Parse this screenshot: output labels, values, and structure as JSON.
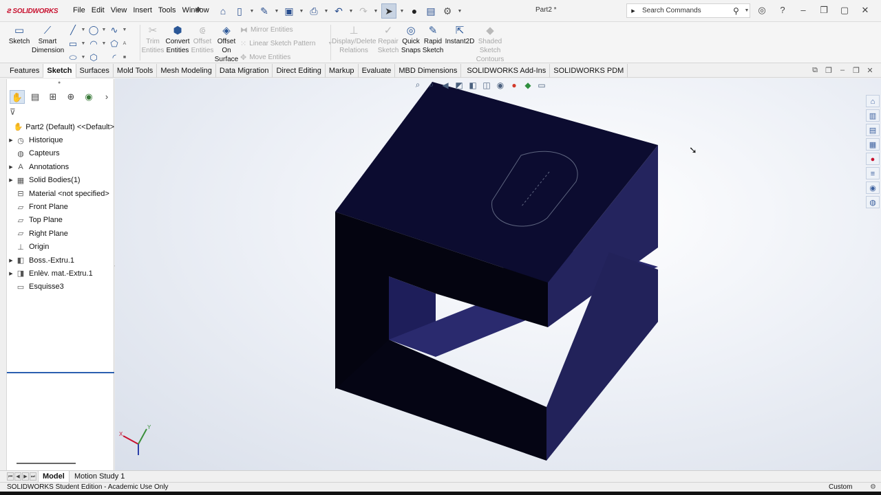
{
  "app": {
    "logo": "SOLIDWORKS",
    "document_title": "Part2 *"
  },
  "menu": [
    "File",
    "Edit",
    "View",
    "Insert",
    "Tools",
    "Window"
  ],
  "search": {
    "placeholder": "Search Commands"
  },
  "commands": {
    "sketch": "Sketch",
    "smart_dimension_1": "Smart",
    "smart_dimension_2": "Dimension",
    "trim_1": "Trim",
    "trim_2": "Entities",
    "convert_1": "Convert",
    "convert_2": "Entities",
    "offset_1": "Offset",
    "offset_2": "Entities",
    "offset_surface_1": "Offset",
    "offset_surface_2": "On",
    "offset_surface_3": "Surface",
    "mirror": "Mirror Entities",
    "linear_pattern": "Linear Sketch Pattern",
    "move": "Move Entities",
    "display_delete_1": "Display/Delete",
    "display_delete_2": "Relations",
    "repair_1": "Repair",
    "repair_2": "Sketch",
    "quick_snaps_1": "Quick",
    "quick_snaps_2": "Snaps",
    "rapid_sketch_1": "Rapid",
    "rapid_sketch_2": "Sketch",
    "instant2d": "Instant2D",
    "shaded_1": "Shaded",
    "shaded_2": "Sketch",
    "shaded_3": "Contours"
  },
  "tabs": [
    "Features",
    "Sketch",
    "Surfaces",
    "Mold Tools",
    "Mesh Modeling",
    "Data Migration",
    "Direct Editing",
    "Markup",
    "Evaluate",
    "MBD Dimensions",
    "SOLIDWORKS Add-Ins",
    "SOLIDWORKS PDM"
  ],
  "active_tab": "Sketch",
  "tree": [
    {
      "label": "Part2 (Default) <<Default>",
      "icon": "part-icon",
      "expandable": false
    },
    {
      "label": "Historique",
      "icon": "history-icon",
      "expandable": true
    },
    {
      "label": "Capteurs",
      "icon": "sensor-icon",
      "expandable": false
    },
    {
      "label": "Annotations",
      "icon": "annotation-icon",
      "expandable": true
    },
    {
      "label": "Solid Bodies(1)",
      "icon": "solid-bodies-icon",
      "expandable": true
    },
    {
      "label": "Material <not specified>",
      "icon": "material-icon",
      "expandable": false
    },
    {
      "label": "Front Plane",
      "icon": "plane-icon",
      "expandable": false
    },
    {
      "label": "Top Plane",
      "icon": "plane-icon",
      "expandable": false
    },
    {
      "label": "Right Plane",
      "icon": "plane-icon",
      "expandable": false
    },
    {
      "label": "Origin",
      "icon": "origin-icon",
      "expandable": false
    },
    {
      "label": "Boss.-Extru.1",
      "icon": "boss-extrude-icon",
      "expandable": true
    },
    {
      "label": "Enlèv. mat.-Extru.1",
      "icon": "cut-extrude-icon",
      "expandable": true
    },
    {
      "label": "Esquisse3",
      "icon": "sketch-icon",
      "expandable": false
    }
  ],
  "triad": {
    "x": "X",
    "y": "Y"
  },
  "bottom_tabs": [
    "Model",
    "Motion Study 1"
  ],
  "status": {
    "left": "SOLIDWORKS Student Edition - Academic Use Only",
    "right": "Custom"
  },
  "colors": {
    "body": "#0b0b2a",
    "accent": "#2b5797",
    "brand": "#c8102e"
  }
}
